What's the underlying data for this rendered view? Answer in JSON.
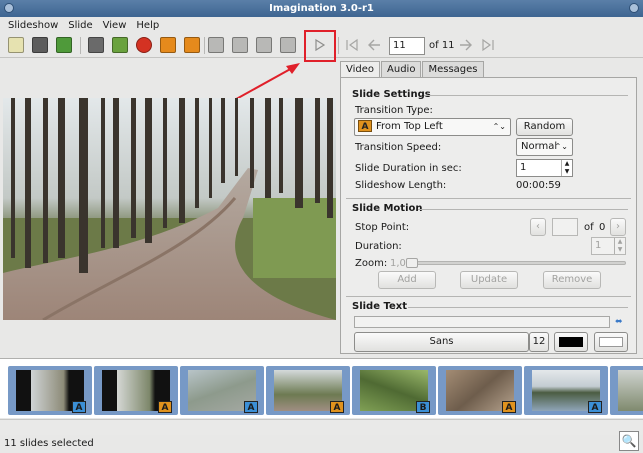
{
  "window": {
    "title": "Imagination 3.0-r1"
  },
  "menu": [
    "Slideshow",
    "Slide",
    "View",
    "Help"
  ],
  "toolbar": {
    "tools": [
      {
        "name": "new-slideshow-icon",
        "color": "#e6e2b0"
      },
      {
        "name": "open-slideshow-icon",
        "color": "#5d5d5d"
      },
      {
        "name": "save-slideshow-icon",
        "color": "#4f9a3a"
      },
      {
        "name": "import-pictures-icon",
        "color": "#6a6a6a"
      },
      {
        "name": "import-music-icon",
        "color": "#6aa23e"
      },
      {
        "name": "delete-slide-icon",
        "color": "#d43222"
      },
      {
        "name": "rotate-left-icon",
        "color": "#e58a1c"
      },
      {
        "name": "rotate-right-icon",
        "color": "#e58a1c"
      },
      {
        "name": "zoom-fit-icon",
        "color": "#b8b8b6"
      },
      {
        "name": "zoom-normal-icon",
        "color": "#b8b8b6"
      },
      {
        "name": "zoom-in-icon",
        "color": "#b8b8b6"
      },
      {
        "name": "zoom-out-icon",
        "color": "#b8b8b6"
      },
      {
        "name": "preview-play-icon",
        "color": "#9a9a98"
      }
    ],
    "current_slide": "11",
    "total_label": "of 11"
  },
  "tabs": [
    "Video",
    "Audio",
    "Messages"
  ],
  "slide_settings": {
    "title": "Slide Settings",
    "transition_type_label": "Transition Type:",
    "transition_badge": "A",
    "transition_value": "From Top Left",
    "random_button": "Random",
    "transition_speed_label": "Transition Speed:",
    "transition_speed_value": "Normal",
    "duration_label": "Slide Duration in sec:",
    "duration_value": "1",
    "length_label": "Slideshow Length:",
    "length_value": "00:00:59"
  },
  "slide_motion": {
    "title": "Slide Motion",
    "stop_point_label": "Stop Point:",
    "stop_point_of": "of",
    "stop_point_total": "0",
    "duration_label": "Duration:",
    "duration_value": "1",
    "zoom_label": "Zoom:",
    "zoom_value": "1,0",
    "add_button": "Add",
    "update_button": "Update",
    "remove_button": "Remove"
  },
  "slide_text": {
    "title": "Slide Text",
    "font_name": "Sans",
    "font_size": "12",
    "fg_color": "#000000",
    "bg_color": "#ffffff"
  },
  "filmstrip": {
    "thumbs": [
      {
        "badge": "A",
        "badge_color": "#3b8fd6"
      },
      {
        "badge": "A",
        "badge_color": "#e0921d"
      },
      {
        "badge": "A",
        "badge_color": "#3b8fd6"
      },
      {
        "badge": "A",
        "badge_color": "#e0921d"
      },
      {
        "badge": "B",
        "badge_color": "#3b8fd6"
      },
      {
        "badge": "A",
        "badge_color": "#e0921d"
      },
      {
        "badge": "A",
        "badge_color": "#3b8fd6"
      }
    ]
  },
  "status": {
    "text": "11 slides selected"
  }
}
